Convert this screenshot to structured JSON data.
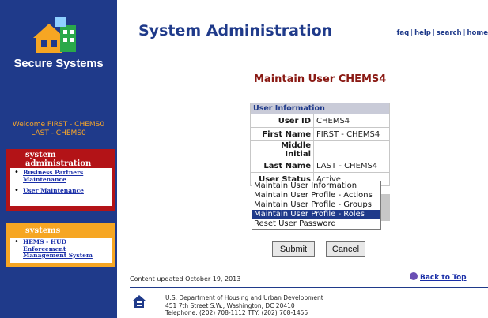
{
  "sidebar": {
    "brand": "Secure Systems",
    "welcome_line1": "Welcome FIRST - CHEMS0",
    "welcome_line2": "LAST - CHEMS0",
    "system_admin": {
      "header_line1": "system",
      "header_line2": "administration",
      "items": [
        "Business Partners Maintenance",
        "User Maintenance"
      ]
    },
    "systems": {
      "header": "systems",
      "items": [
        "HEMS - HUD Enforcement Management System"
      ]
    }
  },
  "header": {
    "title": "System Administration",
    "links": [
      "faq",
      "help",
      "search",
      "home"
    ]
  },
  "main": {
    "page_title": "Maintain User CHEMS4",
    "info_header": "User Information",
    "fields": [
      {
        "label": "User ID",
        "value": "CHEMS4"
      },
      {
        "label": "First Name",
        "value": "FIRST - CHEMS4"
      },
      {
        "label": "Middle Initial",
        "value": ""
      },
      {
        "label": "Last Name",
        "value": "LAST - CHEMS4"
      },
      {
        "label": "User Status",
        "value": "Active"
      }
    ],
    "actions": [
      "Maintain User Information",
      "Maintain User Profile - Actions",
      "Maintain User Profile - Groups",
      "Maintain User Profile - Roles",
      "Reset User Password"
    ],
    "selected_action": "Maintain User Profile - Roles",
    "submit_label": "Submit",
    "cancel_label": "Cancel"
  },
  "footer": {
    "updated": "Content updated October 19, 2013",
    "back_to_top": "Back to Top",
    "address_line1": "U.S. Department of Housing and Urban Development",
    "address_line2": "451 7th Street S.W., Washington, DC 20410",
    "address_line3": "Telephone: (202) 708-1112 TTY: (202) 708-1455"
  },
  "colors": {
    "sidebar_bg": "#1f3a8a",
    "welcome_text": "#f6a52a",
    "admin_box": "#b31317",
    "systems_box": "#f6a623",
    "page_title": "#8a1a14",
    "selection": "#1f3a8a"
  }
}
